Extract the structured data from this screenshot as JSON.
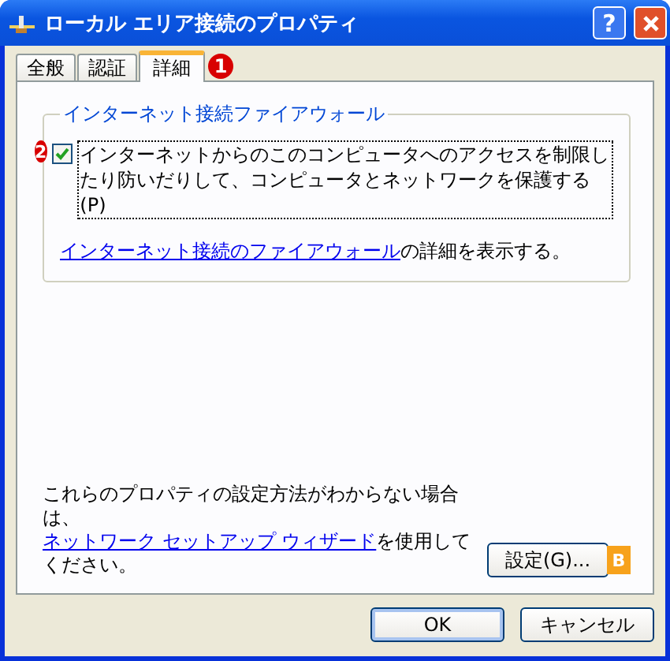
{
  "window": {
    "title": "ローカル エリア接続のプロパティ",
    "help_button": "?"
  },
  "tabs": [
    {
      "label": "全般",
      "selected": false
    },
    {
      "label": "認証",
      "selected": false
    },
    {
      "label": "詳細",
      "selected": true,
      "annotation": "1"
    }
  ],
  "firewall": {
    "group_title": "インターネット接続ファイアウォール",
    "annotation": "2",
    "checkbox": {
      "label": "インターネットからのこのコンピュータへのアクセスを制限したり防いだりして、コンピュータとネットワークを保護する(P)",
      "checked": true
    },
    "info_link": "インターネット接続のファイアウォール",
    "info_rest": "の詳細を表示する。"
  },
  "help": {
    "line1": "これらのプロパティの設定方法がわからない場合は、",
    "link": "ネットワーク セットアップ ウィザード",
    "rest": "を使用してください。"
  },
  "settings_button": {
    "label": "設定(G)...",
    "annotation": "B"
  },
  "buttons": [
    "OK",
    "キャンセル"
  ]
}
